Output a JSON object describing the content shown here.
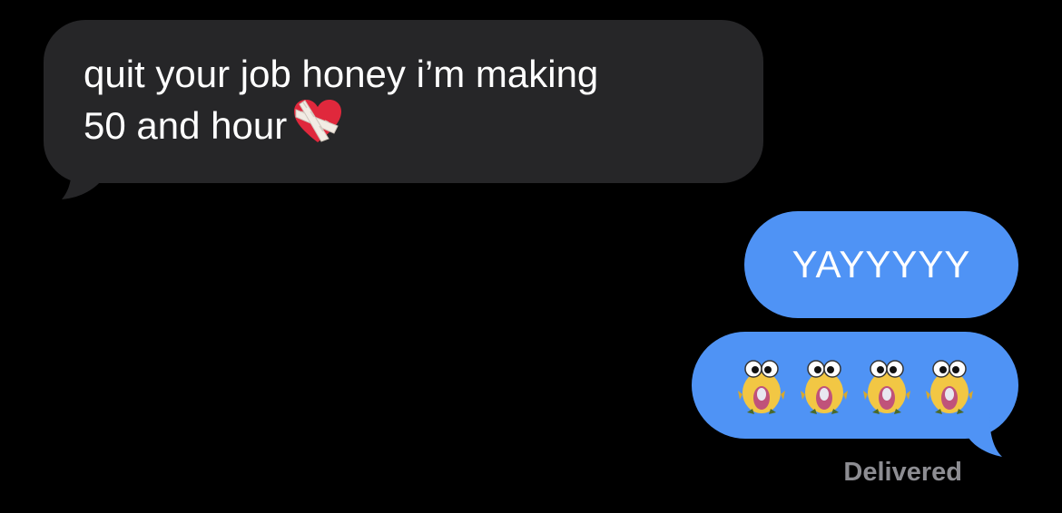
{
  "incoming": {
    "text": "quit your job honey i’m making\n50 and hour",
    "emoji_icon": "mending-heart-icon"
  },
  "outgoing": [
    {
      "text": "YAYYYYY"
    },
    {
      "emoji_icons": [
        "googly-eye-fish-icon",
        "googly-eye-fish-icon",
        "googly-eye-fish-icon",
        "googly-eye-fish-icon"
      ]
    }
  ],
  "status": {
    "receipt": "Delivered"
  },
  "colors": {
    "background": "#000000",
    "incoming_bubble": "#262628",
    "outgoing_bubble": "#4f93f5",
    "receipt_text": "#8d8d92"
  }
}
